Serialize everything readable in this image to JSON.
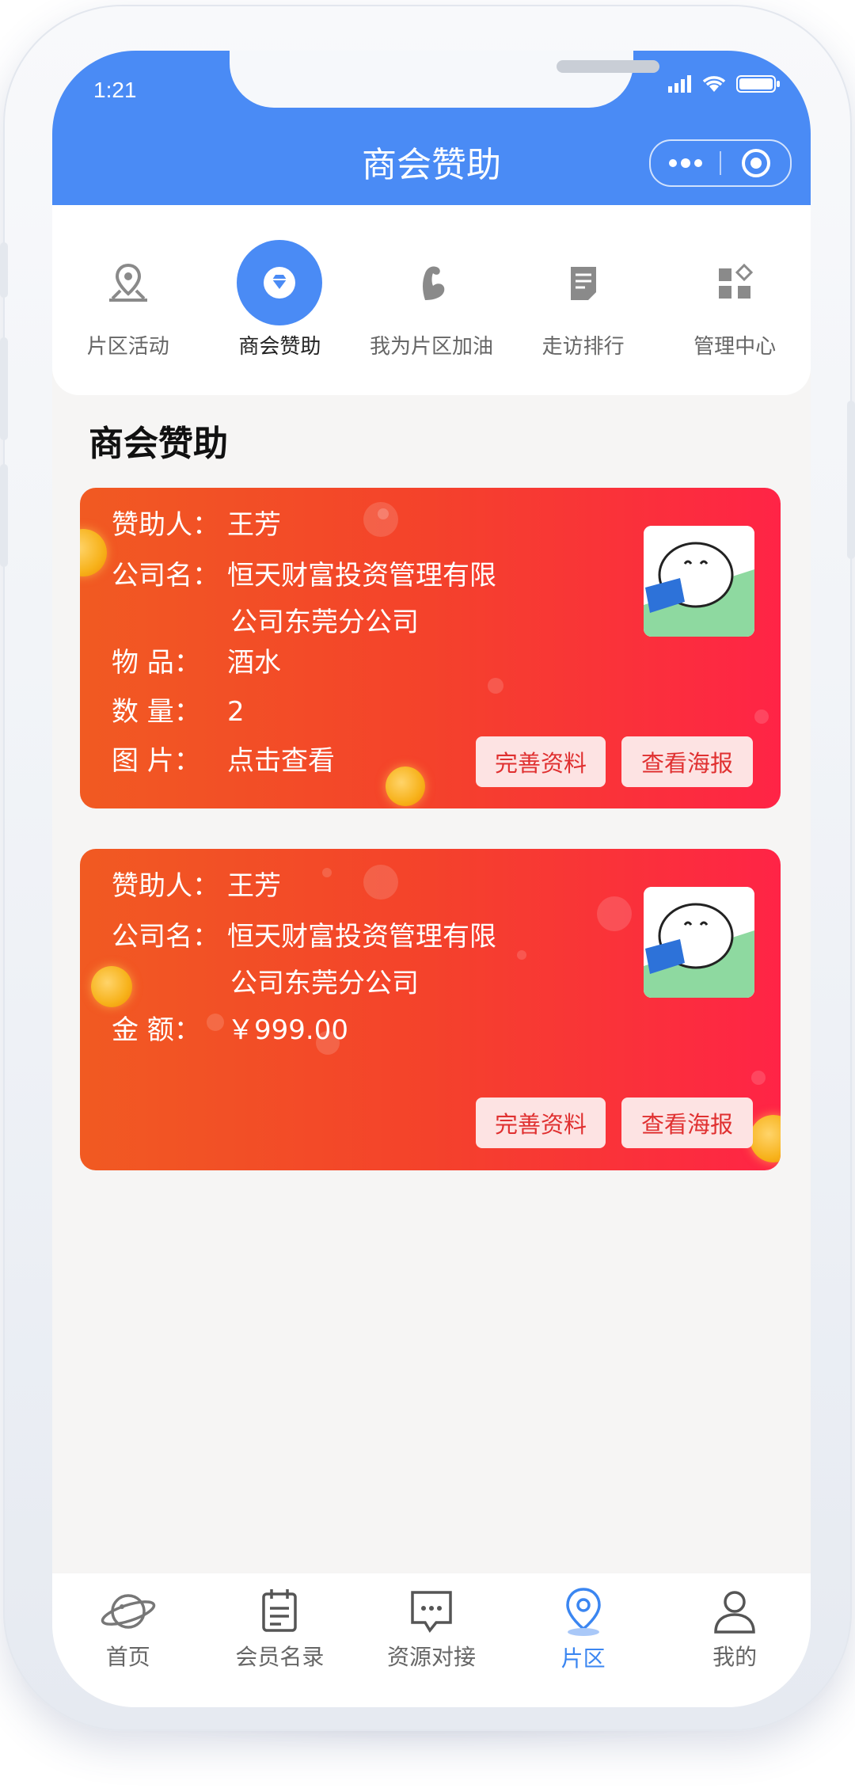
{
  "status": {
    "time": "1:21"
  },
  "header": {
    "title": "商会赞助"
  },
  "topnav": [
    {
      "label": "片区活动",
      "icon": "map-pin-icon"
    },
    {
      "label": "商会赞助",
      "icon": "diamond-icon",
      "active": true
    },
    {
      "label": "我为片区加油",
      "icon": "muscle-icon"
    },
    {
      "label": "走访排行",
      "icon": "clipboard-icon"
    },
    {
      "label": "管理中心",
      "icon": "grid-icon"
    }
  ],
  "section_title": "商会赞助",
  "cards": [
    {
      "sponsor_label": "赞助人：",
      "sponsor": "王芳",
      "company_label": "公司名：",
      "company_line1": "恒天财富投资管理有限",
      "company_line2": "公司东莞分公司",
      "item_label": "物   品：",
      "item": "酒水",
      "qty_label": "数   量：",
      "qty": "2",
      "image_label": "图   片：",
      "image_text": "点击查看",
      "btn_complete": "完善资料",
      "btn_poster": "查看海报"
    },
    {
      "sponsor_label": "赞助人：",
      "sponsor": "王芳",
      "company_label": "公司名：",
      "company_line1": "恒天财富投资管理有限",
      "company_line2": "公司东莞分公司",
      "amount_label": "金   额：",
      "amount": "￥999.00",
      "btn_complete": "完善资料",
      "btn_poster": "查看海报"
    }
  ],
  "tabbar": [
    {
      "label": "首页",
      "icon": "planet-icon"
    },
    {
      "label": "会员名录",
      "icon": "calendar-list-icon"
    },
    {
      "label": "资源对接",
      "icon": "chat-icon"
    },
    {
      "label": "片区",
      "icon": "location-icon",
      "active": true
    },
    {
      "label": "我的",
      "icon": "user-icon"
    }
  ],
  "colors": {
    "primary": "#4a8bf5",
    "card_start": "#f15a22",
    "card_end": "#ff2446",
    "tab_active": "#3b86f1"
  }
}
